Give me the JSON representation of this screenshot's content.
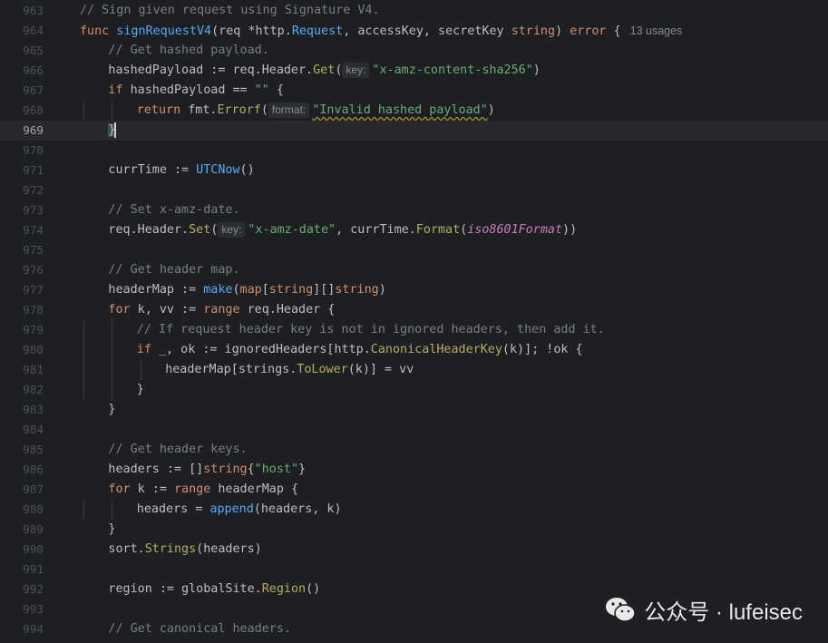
{
  "editor": {
    "lines": [
      {
        "n": "963",
        "indent": 0,
        "tokens": [
          {
            "t": "// Sign given request using Signature V4.",
            "c": "cm"
          }
        ]
      },
      {
        "n": "964",
        "indent": 0,
        "tokens": [
          {
            "t": "func ",
            "c": "kw"
          },
          {
            "t": "signRequestV4",
            "c": "fn"
          },
          {
            "t": "(req *"
          },
          {
            "t": "http",
            "c": "pkg"
          },
          {
            "t": "."
          },
          {
            "t": "Request",
            "c": "call"
          },
          {
            "t": ", accessKey, secretKey "
          },
          {
            "t": "string",
            "c": "type"
          },
          {
            "t": ") "
          },
          {
            "t": "error",
            "c": "type"
          },
          {
            "t": " {"
          }
        ],
        "usages": "13 usages"
      },
      {
        "n": "965",
        "indent": 1,
        "tokens": [
          {
            "t": "// Get hashed payload.",
            "c": "cm"
          }
        ]
      },
      {
        "n": "966",
        "indent": 1,
        "tokens": [
          {
            "t": "hashedPayload := req.Header."
          },
          {
            "t": "Get",
            "c": "meth"
          },
          {
            "t": "("
          },
          {
            "hint": "key:"
          },
          {
            "t": "\"x-amz-content-sha256\"",
            "c": "str"
          },
          {
            "t": ")"
          }
        ]
      },
      {
        "n": "967",
        "indent": 1,
        "tokens": [
          {
            "t": "if ",
            "c": "kw"
          },
          {
            "t": "hashedPayload == "
          },
          {
            "t": "\"\"",
            "c": "str"
          },
          {
            "t": " {"
          }
        ]
      },
      {
        "n": "968",
        "indent": 2,
        "tokens": [
          {
            "t": "return ",
            "c": "kw"
          },
          {
            "t": "fmt."
          },
          {
            "t": "Errorf",
            "c": "meth"
          },
          {
            "t": "("
          },
          {
            "hint": "format:"
          },
          {
            "t": "\"Invalid hashed payload\"",
            "c": "strWavy"
          },
          {
            "t": ")"
          }
        ]
      },
      {
        "n": "969",
        "indent": 1,
        "current": true,
        "tokens": [
          {
            "t": "}",
            "c": "brace-hl"
          },
          {
            "caret": true
          }
        ]
      },
      {
        "n": "970",
        "indent": 0,
        "tokens": []
      },
      {
        "n": "971",
        "indent": 1,
        "tokens": [
          {
            "t": "currTime := "
          },
          {
            "t": "UTCNow",
            "c": "call"
          },
          {
            "t": "()"
          }
        ]
      },
      {
        "n": "972",
        "indent": 0,
        "tokens": []
      },
      {
        "n": "973",
        "indent": 1,
        "tokens": [
          {
            "t": "// Set x-amz-date.",
            "c": "cm"
          }
        ]
      },
      {
        "n": "974",
        "indent": 1,
        "tokens": [
          {
            "t": "req.Header."
          },
          {
            "t": "Set",
            "c": "meth"
          },
          {
            "t": "("
          },
          {
            "hint": "key:"
          },
          {
            "t": "\"x-amz-date\"",
            "c": "str"
          },
          {
            "t": ", currTime."
          },
          {
            "t": "Format",
            "c": "meth"
          },
          {
            "t": "("
          },
          {
            "t": "iso8601Format",
            "c": "const"
          },
          {
            "t": "))"
          }
        ]
      },
      {
        "n": "975",
        "indent": 0,
        "tokens": []
      },
      {
        "n": "976",
        "indent": 1,
        "tokens": [
          {
            "t": "// Get header map.",
            "c": "cm"
          }
        ]
      },
      {
        "n": "977",
        "indent": 1,
        "tokens": [
          {
            "t": "headerMap := "
          },
          {
            "t": "make",
            "c": "call"
          },
          {
            "t": "("
          },
          {
            "t": "map",
            "c": "kw"
          },
          {
            "t": "["
          },
          {
            "t": "string",
            "c": "type"
          },
          {
            "t": "][]"
          },
          {
            "t": "string",
            "c": "type"
          },
          {
            "t": ")"
          }
        ]
      },
      {
        "n": "978",
        "indent": 1,
        "tokens": [
          {
            "t": "for ",
            "c": "kw"
          },
          {
            "t": "k, vv := "
          },
          {
            "t": "range ",
            "c": "kw"
          },
          {
            "t": "req.Header {"
          }
        ]
      },
      {
        "n": "979",
        "indent": 2,
        "tokens": [
          {
            "t": "// If request header key is not in ignored headers, then add it.",
            "c": "cm"
          }
        ]
      },
      {
        "n": "980",
        "indent": 2,
        "tokens": [
          {
            "t": "if ",
            "c": "kw"
          },
          {
            "t": "_, ok := ignoredHeaders["
          },
          {
            "t": "http",
            "c": "pkg"
          },
          {
            "t": "."
          },
          {
            "t": "CanonicalHeaderKey",
            "c": "meth"
          },
          {
            "t": "(k)]; !ok {"
          }
        ]
      },
      {
        "n": "981",
        "indent": 3,
        "tokens": [
          {
            "t": "headerMap["
          },
          {
            "t": "strings",
            "c": "pkg"
          },
          {
            "t": "."
          },
          {
            "t": "ToLower",
            "c": "meth"
          },
          {
            "t": "(k)] = vv"
          }
        ]
      },
      {
        "n": "982",
        "indent": 2,
        "tokens": [
          {
            "t": "}"
          }
        ]
      },
      {
        "n": "983",
        "indent": 1,
        "tokens": [
          {
            "t": "}"
          }
        ]
      },
      {
        "n": "984",
        "indent": 0,
        "tokens": []
      },
      {
        "n": "985",
        "indent": 1,
        "tokens": [
          {
            "t": "// Get header keys.",
            "c": "cm"
          }
        ]
      },
      {
        "n": "986",
        "indent": 1,
        "tokens": [
          {
            "t": "headers := []"
          },
          {
            "t": "string",
            "c": "type"
          },
          {
            "t": "{"
          },
          {
            "t": "\"host\"",
            "c": "str"
          },
          {
            "t": "}"
          }
        ]
      },
      {
        "n": "987",
        "indent": 1,
        "tokens": [
          {
            "t": "for ",
            "c": "kw"
          },
          {
            "t": "k := "
          },
          {
            "t": "range ",
            "c": "kw"
          },
          {
            "t": "headerMap {"
          }
        ]
      },
      {
        "n": "988",
        "indent": 2,
        "tokens": [
          {
            "t": "headers = "
          },
          {
            "t": "append",
            "c": "call"
          },
          {
            "t": "(headers, k)"
          }
        ]
      },
      {
        "n": "989",
        "indent": 1,
        "tokens": [
          {
            "t": "}"
          }
        ]
      },
      {
        "n": "990",
        "indent": 1,
        "tokens": [
          {
            "t": "sort",
            "c": "pkg"
          },
          {
            "t": "."
          },
          {
            "t": "Strings",
            "c": "meth"
          },
          {
            "t": "(headers)"
          }
        ]
      },
      {
        "n": "991",
        "indent": 0,
        "tokens": []
      },
      {
        "n": "992",
        "indent": 1,
        "tokens": [
          {
            "t": "region := globalSite."
          },
          {
            "t": "Region",
            "c": "meth"
          },
          {
            "t": "()"
          }
        ]
      },
      {
        "n": "993",
        "indent": 0,
        "tokens": []
      },
      {
        "n": "994",
        "indent": 1,
        "tokens": [
          {
            "t": "// Get canonical headers.",
            "c": "cm"
          }
        ]
      }
    ]
  },
  "watermark": {
    "text": "公众号 · lufeisec",
    "icon": "wechat-icon"
  },
  "colors": {
    "background": "#1e1f22",
    "keyword": "#cf8e6d",
    "function": "#56a8f5",
    "string": "#6aab73",
    "comment": "#7a7e85"
  }
}
